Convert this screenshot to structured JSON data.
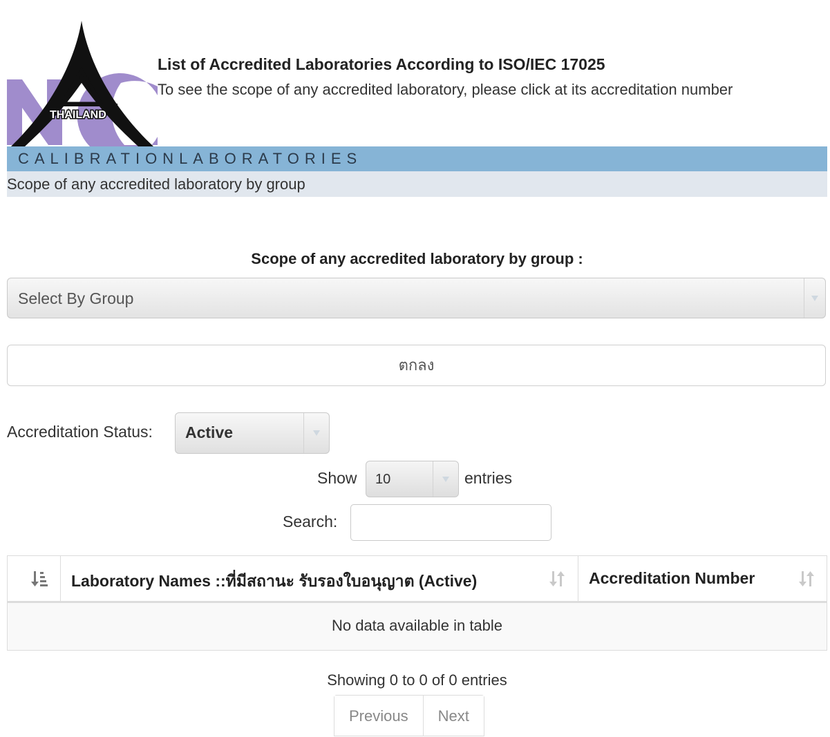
{
  "header": {
    "logo_text": "THAILAND",
    "title": "List of Accredited Laboratories According to ISO/IEC 17025",
    "subtitle": "To see the scope of any accredited laboratory, please click at its accreditation number"
  },
  "band": {
    "title": "CALIBRATIONLABORATORIES",
    "subtitle": "Scope of any accredited laboratory by group"
  },
  "group_filter": {
    "label": "Scope of any accredited laboratory by group :",
    "selected": "Select By Group",
    "submit_label": "ตกลง"
  },
  "status_filter": {
    "label": "Accreditation Status:",
    "selected": "Active"
  },
  "entries": {
    "show_label": "Show",
    "selected": "10",
    "suffix_label": "entries"
  },
  "search": {
    "label": "Search:",
    "value": ""
  },
  "table": {
    "columns": [
      "",
      "Laboratory Names ::ที่มีสถานะ รับรองใบอนุญาต (Active)",
      "Accreditation Number"
    ],
    "empty_message": "No data available in table"
  },
  "pagination": {
    "info": "Showing 0 to 0 of 0 entries",
    "previous_label": "Previous",
    "next_label": "Next"
  },
  "colors": {
    "band": "#86b4d6",
    "sub_band": "#e1e7ee",
    "logo_purple": "#9b87c9"
  }
}
